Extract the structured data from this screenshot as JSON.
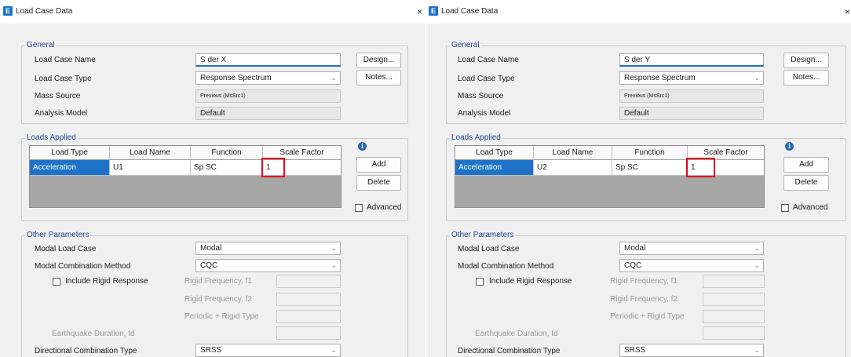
{
  "dialogs": [
    {
      "window_title": "Load Case Data",
      "app_icon_letter": "E",
      "general_legend": "General",
      "load_case_name_label": "Load Case Name",
      "load_case_name": "S der X",
      "load_case_type_label": "Load Case Type",
      "load_case_type": "Response Spectrum",
      "mass_source_label": "Mass Source",
      "mass_source": "Previous  (MsSrc1)",
      "analysis_model_label": "Analysis Model",
      "analysis_model": "Default",
      "design_button": "Design...",
      "notes_button": "Notes...",
      "loads_legend": "Loads Applied",
      "columns": [
        "Load Type",
        "Load Name",
        "Function",
        "Scale Factor"
      ],
      "row": [
        "Acceleration",
        "U1",
        "Sp SC",
        "1"
      ],
      "add_button": "Add",
      "delete_button": "Delete",
      "advanced_label": "Advanced",
      "other_legend": "Other Parameters",
      "modal_load_case_label": "Modal Load Case",
      "modal_load_case": "Modal",
      "modal_combination_label": "Modal Combination Method",
      "modal_combination": "CQC",
      "include_rigid_label": "Include Rigid Response",
      "rigid_f1_label": "Rigid Frequency, f1",
      "rigid_f2_label": "Rigid Frequency, f2",
      "periodic_rigid_label": "Periodic + Rigid Type",
      "earthquake_duration_label": "Earthquake Duration, td",
      "directional_combination_label": "Directional Combination Type",
      "directional_combination": "SRSS"
    },
    {
      "window_title": "Load Case Data",
      "app_icon_letter": "E",
      "general_legend": "General",
      "load_case_name_label": "Load Case Name",
      "load_case_name": "S der Y",
      "load_case_type_label": "Load Case Type",
      "load_case_type": "Response Spectrum",
      "mass_source_label": "Mass Source",
      "mass_source": "Previous  (MsSrc1)",
      "analysis_model_label": "Analysis Model",
      "analysis_model": "Default",
      "design_button": "Design...",
      "notes_button": "Notes...",
      "loads_legend": "Loads Applied",
      "columns": [
        "Load Type",
        "Load Name",
        "Function",
        "Scale Factor"
      ],
      "row": [
        "Acceleration",
        "U2",
        "Sp SC",
        "1"
      ],
      "add_button": "Add",
      "delete_button": "Delete",
      "advanced_label": "Advanced",
      "other_legend": "Other Parameters",
      "modal_load_case_label": "Modal Load Case",
      "modal_load_case": "Modal",
      "modal_combination_label": "Modal Combination Method",
      "modal_combination": "CQC",
      "include_rigid_label": "Include Rigid Response",
      "rigid_f1_label": "Rigid Frequency, f1",
      "rigid_f2_label": "Rigid Frequency, f2",
      "periodic_rigid_label": "Periodic + Rigid Type",
      "earthquake_duration_label": "Earthquake Duration, td",
      "directional_combination_label": "Directional Combination Type",
      "directional_combination": "SRSS"
    }
  ],
  "icons": {
    "close": "×",
    "dropdown": "chevron-down",
    "info": "info-circle"
  },
  "colors": {
    "accent": "#1e73c8",
    "highlight_box": "#e3001b",
    "legend_text": "#1c3f8f"
  }
}
